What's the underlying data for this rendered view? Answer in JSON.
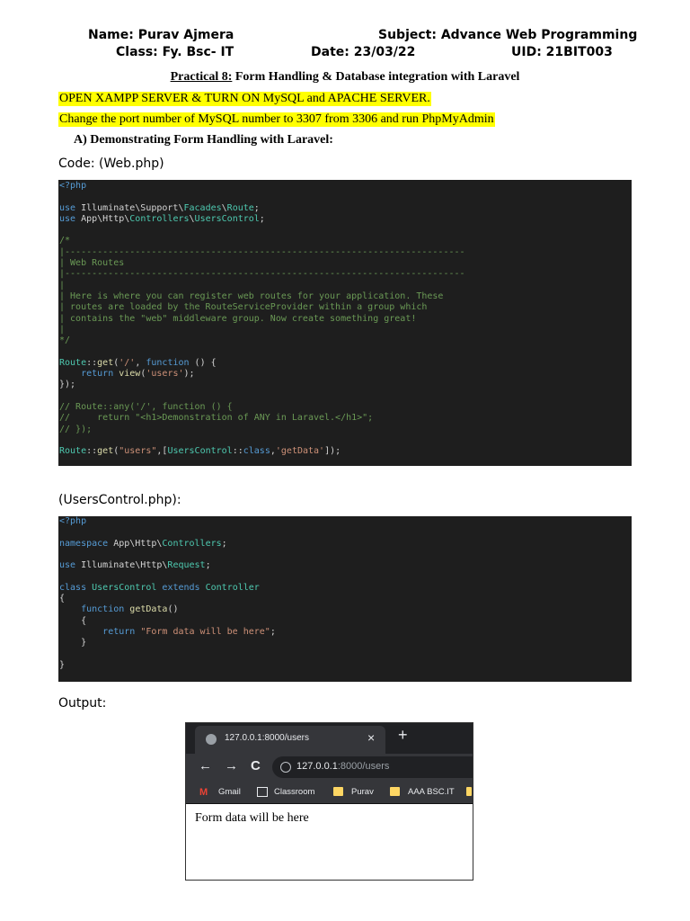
{
  "header": {
    "name": "Name: Purav Ajmera",
    "subject": "Subject: Advance Web Programming",
    "class": "Class: Fy. Bsc- IT",
    "date": "Date: 23/03/22",
    "uid": "UID: 21BIT003"
  },
  "title": {
    "prefix": "Practical 8:",
    "text": " Form Handling & Database integration with Laravel"
  },
  "highlights": [
    "OPEN XAMPP SERVER & TURN ON MySQL and APACHE SERVER.",
    "Change the port number of MySQL number to 3307 from 3306 and run PhpMyAdmin"
  ],
  "section": "A) Demonstrating Form Handling with Laravel:",
  "code_label": "Code: (Web.php)",
  "code1": [
    "<?php",
    "",
    "use Illuminate\\Support\\Facades\\Route;",
    "use App\\Http\\Controllers\\UsersControl;",
    "",
    "/*",
    "|--------------------------------------------------------------------------",
    "| Web Routes",
    "|--------------------------------------------------------------------------",
    "|",
    "| Here is where you can register web routes for your application. These",
    "| routes are loaded by the RouteServiceProvider within a group which",
    "| contains the \"web\" middleware group. Now create something great!",
    "|",
    "*/",
    "",
    "Route::get('/', function () {",
    "    return view('users');",
    "});",
    "",
    "// Route::any('/', function () {",
    "//     return \"<h1>Demonstration of ANY in Laravel.</h1>\";",
    "// });",
    "",
    "Route::get(\"users\",[UsersControl::class,'getData']);"
  ],
  "code2_label": "(UsersControl.php):",
  "code2": [
    "<?php",
    "",
    "namespace App\\Http\\Controllers;",
    "",
    "use Illuminate\\Http\\Request;",
    "",
    "class UsersControl extends Controller",
    "{",
    "    function getData()",
    "    {",
    "        return \"Form data will be here\";",
    "    }",
    "",
    "}"
  ],
  "output_label": "Output:",
  "browser": {
    "tab_title": "127.0.0.1:8000/users",
    "tab_close": "×",
    "new_tab": "+",
    "back": "←",
    "forward": "→",
    "reload": "C",
    "url_host": "127.0.0.1",
    "url_rest": ":8000/users",
    "gmail_glyph": "M",
    "bookmarks": [
      "Gmail",
      "Classroom",
      "Purav",
      "AAA BSC.IT"
    ],
    "page_text": "Form data will be here"
  },
  "colors": {
    "code_bg": "#1e1e1e",
    "keyword": "#569cd6",
    "class": "#4ec9b0",
    "comment": "#6a9955",
    "string": "#ce9178",
    "highlight": "#ffff00"
  }
}
